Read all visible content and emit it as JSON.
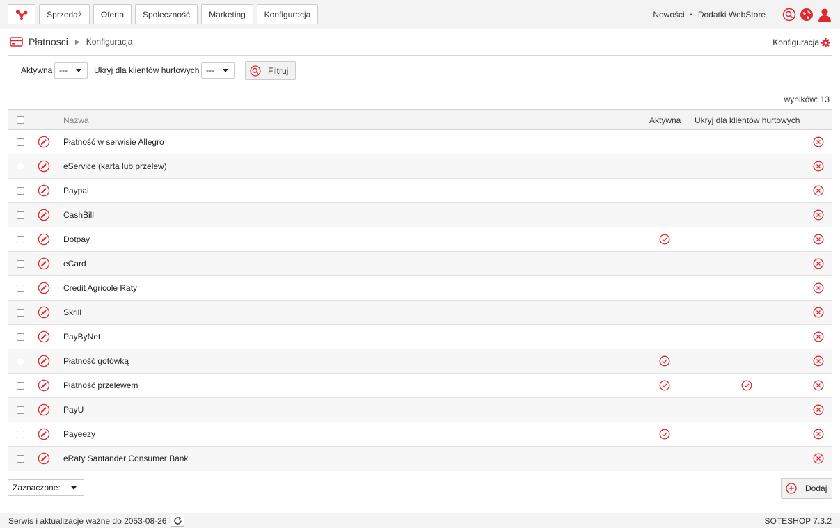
{
  "topbar": {
    "nav": [
      "Sprzedaż",
      "Oferta",
      "Społeczność",
      "Marketing",
      "Konfiguracja"
    ],
    "links": [
      "Nowości",
      "Dodatki WebStore"
    ],
    "separator": "•"
  },
  "breadcrumb": {
    "title": "Płatnosci",
    "separator": "▶",
    "current": "Konfiguracja"
  },
  "config_link": "Konfiguracja",
  "filter": {
    "active_label": "Aktywna",
    "active_value": "---",
    "hide_label": "Ukryj dla klientów hurtowych",
    "hide_value": "---",
    "button": "Filtruj"
  },
  "results": "wyników: 13",
  "table": {
    "columns": {
      "name": "Nazwa",
      "active": "Aktywna",
      "hide": "Ukryj dla klientów hurtowych"
    },
    "rows": [
      {
        "name": "Płatność w serwisie Allegro",
        "active": false,
        "hide": false
      },
      {
        "name": "eService (karta lub przelew)",
        "active": false,
        "hide": false
      },
      {
        "name": "Paypal",
        "active": false,
        "hide": false
      },
      {
        "name": "CashBill",
        "active": false,
        "hide": false
      },
      {
        "name": "Dotpay",
        "active": true,
        "hide": false
      },
      {
        "name": "eCard",
        "active": false,
        "hide": false
      },
      {
        "name": "Credit Agricole Raty",
        "active": false,
        "hide": false
      },
      {
        "name": "Skrill",
        "active": false,
        "hide": false
      },
      {
        "name": "PayByNet",
        "active": false,
        "hide": false
      },
      {
        "name": "Płatność gotówką",
        "active": true,
        "hide": false
      },
      {
        "name": "Płatność przelewem",
        "active": true,
        "hide": true
      },
      {
        "name": "PayU",
        "active": false,
        "hide": false
      },
      {
        "name": "Payeezy",
        "active": true,
        "hide": false
      },
      {
        "name": "eRaty Santander Consumer Bank",
        "active": false,
        "hide": false
      }
    ]
  },
  "bulk": {
    "label": "Zaznaczone:"
  },
  "add_button": "Dodaj",
  "footer": {
    "service": "Serwis i aktualizacje ważne do 2053-08-26",
    "version": "SOTESHOP 7.3.2"
  },
  "colors": {
    "accent": "#e0282f"
  }
}
